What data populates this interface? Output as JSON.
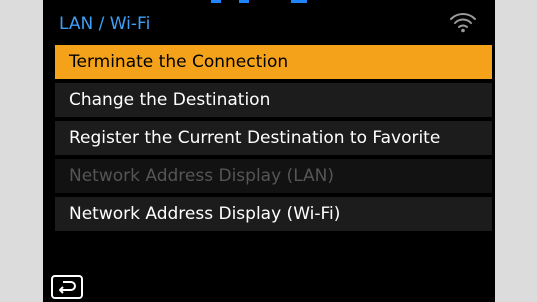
{
  "header": {
    "title": "LAN / Wi-Fi",
    "title_color": "#3e9ff5",
    "status_icon": "wifi-signal-icon"
  },
  "top_strip": {
    "colors": [
      "#1f84ff",
      "#1f84ff",
      "#1f84ff"
    ]
  },
  "menu": {
    "items": [
      {
        "label": "Terminate the Connection",
        "state": "selected"
      },
      {
        "label": "Change the Destination",
        "state": "normal"
      },
      {
        "label": "Register the Current Destination to Favorite",
        "state": "normal"
      },
      {
        "label": "Network Address Display (LAN)",
        "state": "disabled"
      },
      {
        "label": "Network Address Display (Wi-Fi)",
        "state": "normal"
      }
    ],
    "highlight_color": "#f5a21b"
  },
  "footer": {
    "back_icon": "return-arrow-icon"
  }
}
